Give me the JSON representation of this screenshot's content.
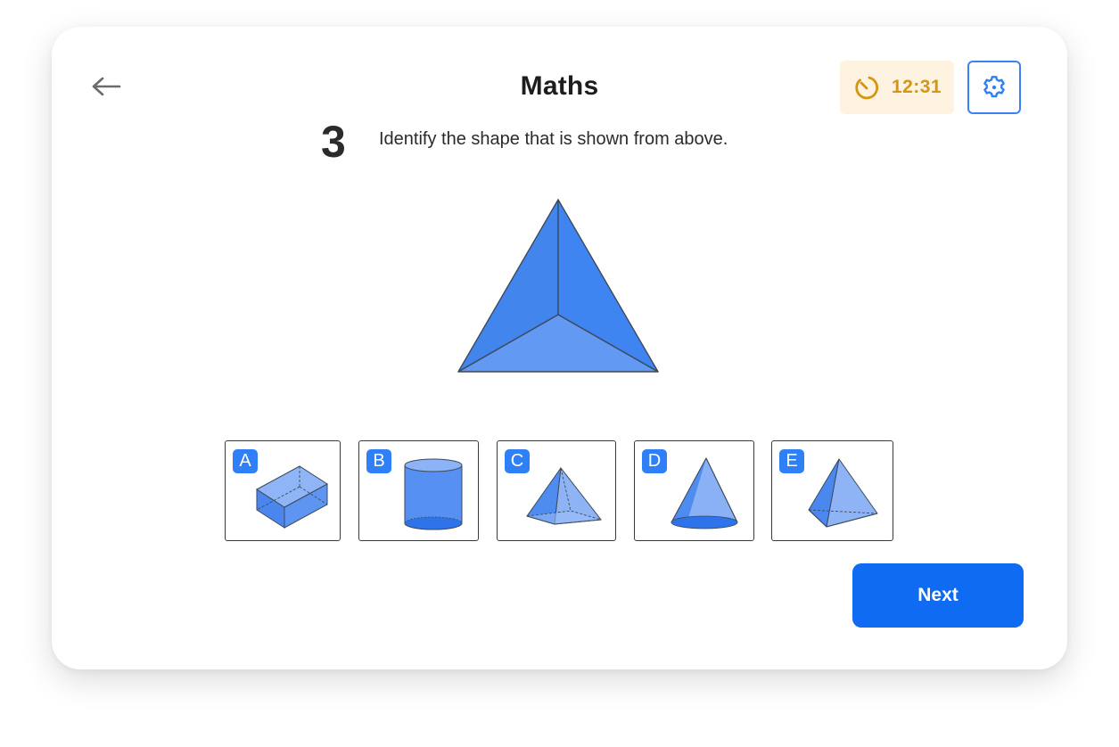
{
  "header": {
    "title": "Maths",
    "back_icon": "arrow-left-icon",
    "timer": {
      "icon": "timer-icon",
      "value": "12:31"
    },
    "settings_icon": "gear-icon"
  },
  "question": {
    "number": "3",
    "text": "Identify the shape that is shown from above."
  },
  "main_figure": {
    "description": "triangular pyramid viewed from above",
    "colors": {
      "left_face": "#4285ec",
      "right_face": "#3f85f2",
      "bottom_face": "#6199f3",
      "edge": "#3d4a5c"
    }
  },
  "options": [
    {
      "label": "A",
      "shape": "cuboid"
    },
    {
      "label": "B",
      "shape": "cylinder"
    },
    {
      "label": "C",
      "shape": "square-based pyramid"
    },
    {
      "label": "D",
      "shape": "cone"
    },
    {
      "label": "E",
      "shape": "triangular pyramid"
    }
  ],
  "footer": {
    "next_label": "Next"
  },
  "colors": {
    "accent": "#0f6bf2",
    "badge": "#2f80f6",
    "timer_bg": "#fdf3e0",
    "timer_text": "#d49613",
    "settings_border": "#3b82f6"
  }
}
